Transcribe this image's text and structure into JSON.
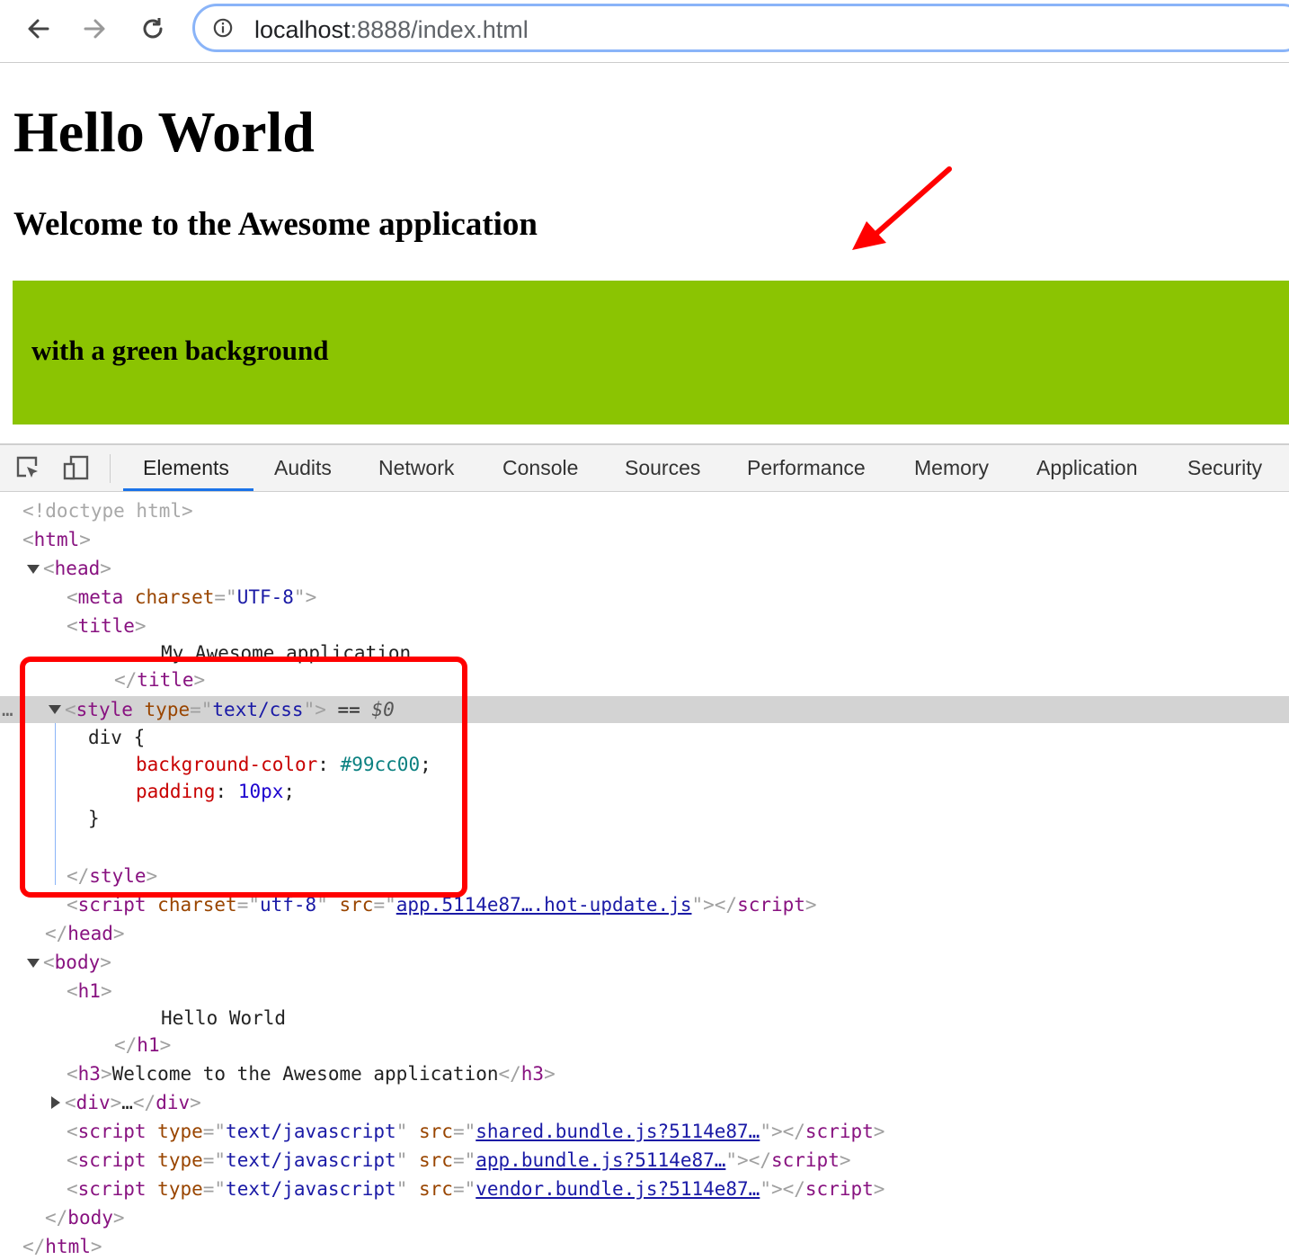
{
  "browser": {
    "url_host": "localhost",
    "url_path": ":8888/index.html"
  },
  "page": {
    "h1": "Hello World",
    "h3": "Welcome to the Awesome application",
    "div_text": "with a green background"
  },
  "colors": {
    "green_bg": "#8bc402",
    "annotation": "#ff0000",
    "tab_active": "#1a73e8"
  },
  "devtools": {
    "tabs": [
      "Elements",
      "Audits",
      "Network",
      "Console",
      "Sources",
      "Performance",
      "Memory",
      "Application",
      "Security"
    ],
    "active_tab": "Elements"
  },
  "tree": {
    "doctype": "<!doctype html>",
    "html_open": "html",
    "head": "head",
    "meta": "meta",
    "charset_attr": "charset",
    "charset_val": "UTF-8",
    "title": "title",
    "title_text": "My Awesome application",
    "style": "style",
    "type_attr": "type",
    "style_type": "text/css",
    "dollar": "$0",
    "css_selector": "div {",
    "css_prop1": "background-color",
    "css_val1": "#99cc00",
    "css_prop2": "padding",
    "css_val2": "10px",
    "css_close": "}",
    "script": "script",
    "src_attr": "src",
    "script1_charset": "utf-8",
    "script1_src": "app.5114e87….hot-update.js",
    "body": "body",
    "h1": "h1",
    "h1_text": "Hello World",
    "h3": "h3",
    "h3_text": "Welcome to the Awesome application",
    "div": "div",
    "ellipsis": "…",
    "js_type": "text/javascript",
    "script2_src": "shared.bundle.js?5114e87…",
    "script3_src": "app.bundle.js?5114e87…",
    "script4_src": "vendor.bundle.js?5114e87…",
    "eq": "=="
  }
}
